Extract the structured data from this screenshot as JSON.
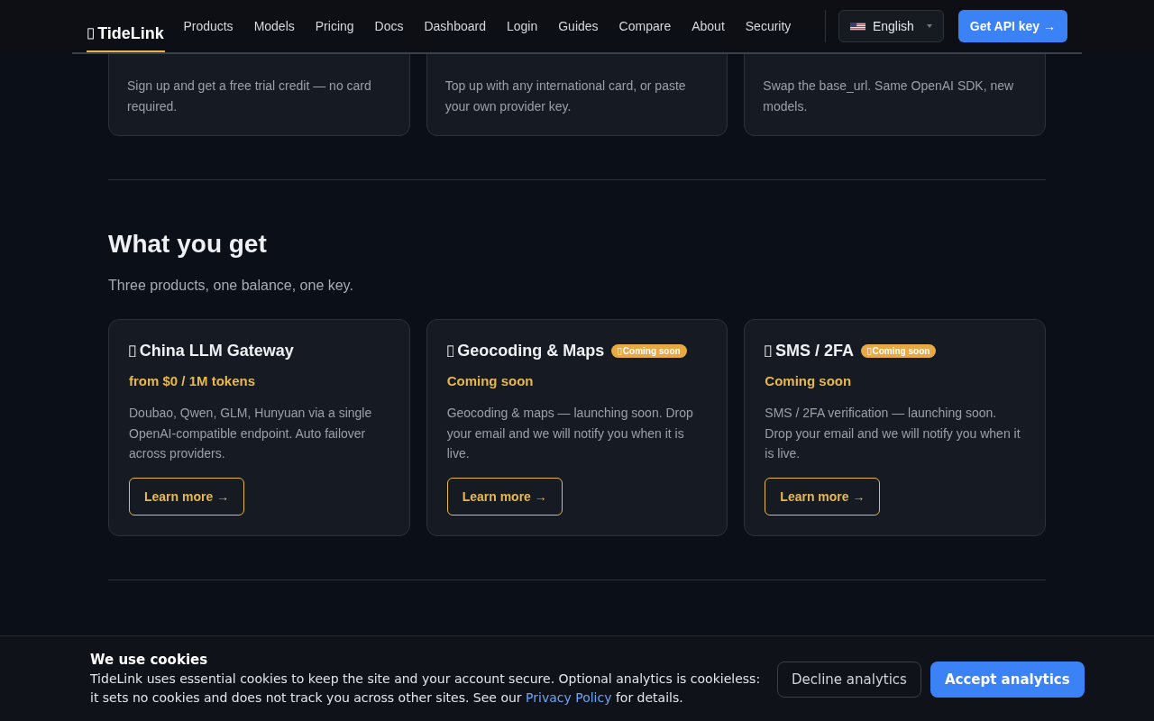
{
  "header": {
    "logo": "TideLink",
    "nav": [
      {
        "label": "Products"
      },
      {
        "label": "Models"
      },
      {
        "label": "Pricing"
      },
      {
        "label": "Docs"
      },
      {
        "label": "Dashboard"
      },
      {
        "label": "Login"
      },
      {
        "label": "Guides"
      },
      {
        "label": "Compare"
      },
      {
        "label": "About"
      },
      {
        "label": "Security"
      }
    ],
    "language": "English",
    "cta": "Get API key →"
  },
  "steps": [
    {
      "text": "Sign up and get a free trial credit — no card required."
    },
    {
      "text": "Top up with any international card, or paste your own provider key."
    },
    {
      "text": "Swap the base_url. Same OpenAI SDK, new models."
    }
  ],
  "section": {
    "title": "What you get",
    "subtitle": "Three products, one balance, one key."
  },
  "products": [
    {
      "title": "China LLM Gateway",
      "price": "from $0 / 1M tokens",
      "text": "Doubao, Qwen, GLM, Hunyuan via a single OpenAI-compatible endpoint. Auto failover across providers.",
      "button": "Learn more →"
    },
    {
      "title": "Geocoding & Maps",
      "badge": "Coming soon",
      "price": "Coming soon",
      "text": "Geocoding & maps — launching soon. Drop your email and we will notify you when it is live.",
      "button": "Learn more →"
    },
    {
      "title": "SMS / 2FA",
      "badge": "Coming soon",
      "price": "Coming soon",
      "text": "SMS / 2FA verification — launching soon. Drop your email and we will notify you when it is live.",
      "button": "Learn more →"
    }
  ],
  "cookie_banner": {
    "title": "We use cookies",
    "text_before": "TideLink uses essential cookies to keep the site and your account secure. Optional analytics is cookieless: it sets no cookies and does not track you across other sites. See our ",
    "link": "Privacy Policy",
    "text_after": " for details.",
    "buttons": [
      {
        "label": "Decline analytics",
        "kind": "secondary"
      },
      {
        "label": "Accept analytics",
        "kind": "primary"
      }
    ]
  }
}
